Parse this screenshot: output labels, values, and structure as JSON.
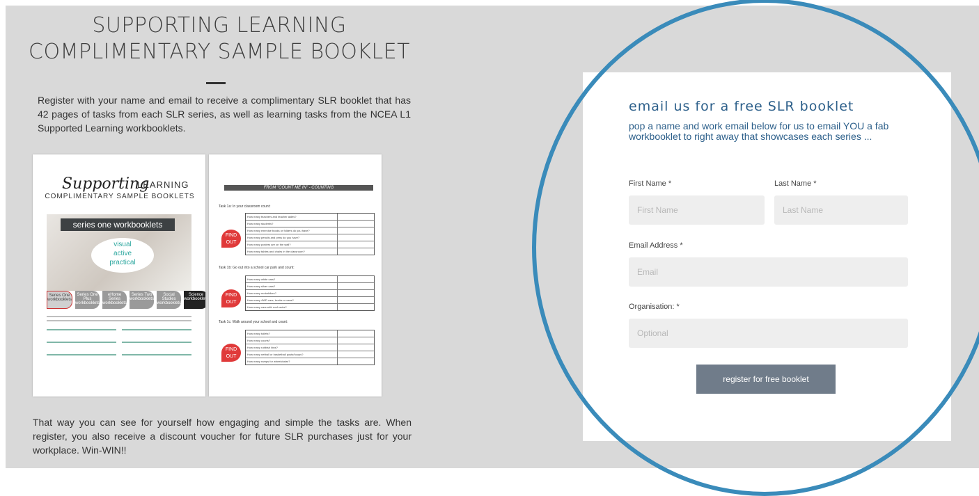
{
  "promo": {
    "title_line1": "SUPPORTING LEARNING",
    "title_line2": "COMPLIMENTARY SAMPLE BOOKLET",
    "intro": "Register with your name and email to receive a complimentary SLR booklet that has 42 pages of tasks from each SLR series, as well as learning tasks from the NCEA L1 Supported Learning workbooklets.",
    "outro": "That way you can see for yourself how engaging and simple the tasks are.  When register, you also receive a discount voucher for future SLR purchases just for your workplace. Win-WIN!!"
  },
  "booklet_left": {
    "script_title": "Supporting",
    "title_word": "LEARNING",
    "subtitle": "COMPLIMENTARY SAMPLE BOOKLETS",
    "banner": "series one workbooklets",
    "oval_words": [
      "visual",
      "active",
      "practical"
    ],
    "tabs": [
      "Series One workbooklets",
      "Series One Plus workbooklets",
      "eHome Series workbooklets",
      "Series Two workbooklets",
      "Social Studies workbooklets",
      "Science workbooklets"
    ]
  },
  "booklet_right": {
    "header": "FROM \"COUNT ME IN\" - COUNTING",
    "task1": "Task 1a:   In your classroom count:",
    "task2": "Task 1b:   Go out into a school car park and count:",
    "task3": "Task 1c:   Walk around your school and count:",
    "pin": "FIND OUT",
    "rows1": [
      "How many teachers and teacher aides?",
      "How many students?",
      "How many exercise books or folders do you have?",
      "How many pencils and pens do you have?",
      "How many posters are on the wall?",
      "How many tables and chairs in the classroom?"
    ],
    "rows2": [
      "How many white cars?",
      "How many silver cars?",
      "How many motorbikes?",
      "How many 4WD cars, trucks or vans?",
      "How many cars with roof racks?"
    ],
    "rows3": [
      "How many toilets?",
      "How many courts?",
      "How many rubbish bins?",
      "How many netball or basketball posts/hoops?",
      "How many ramps for wheelchairs?"
    ]
  },
  "form": {
    "heading": "email us for a free SLR booklet",
    "subheading": "pop a name and work email below for us to email YOU a fab workbooklet to right away that showcases each series ...",
    "first_name_label": "First Name *",
    "first_name_placeholder": "First Name",
    "last_name_label": "Last Name *",
    "last_name_placeholder": "Last Name",
    "email_label": "Email Address *",
    "email_placeholder": "Email",
    "org_label": "Organisation: *",
    "org_placeholder": "Optional",
    "submit_label": "register for free booklet"
  },
  "colors": {
    "ring": "#3a8bba",
    "heading": "#2c5f8a",
    "button": "#707c8a",
    "panel": "#d9d9d9"
  }
}
